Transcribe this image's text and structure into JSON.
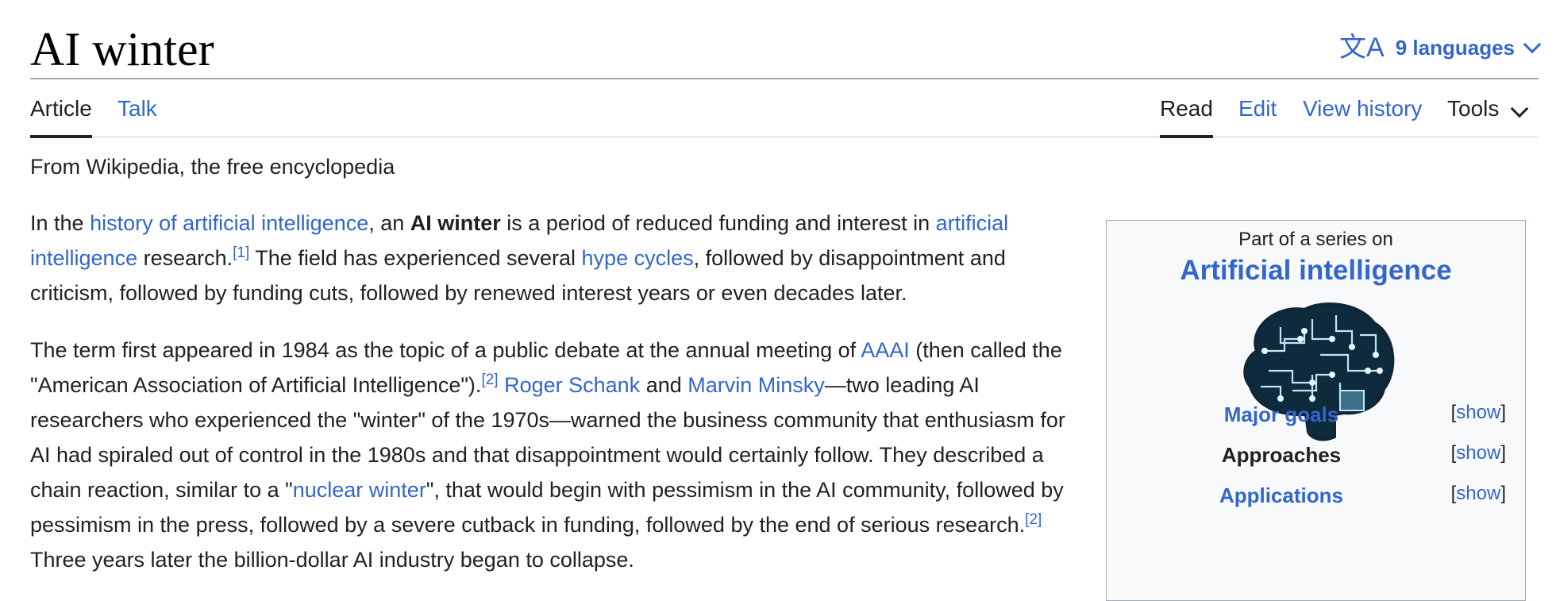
{
  "page": {
    "title": "AI winter",
    "languages_label": "9 languages",
    "tagline": "From Wikipedia, the free encyclopedia"
  },
  "tabs": {
    "left": [
      {
        "label": "Article",
        "active": true
      },
      {
        "label": "Talk",
        "active": false
      }
    ],
    "right": [
      {
        "label": "Read",
        "active": true
      },
      {
        "label": "Edit",
        "active": false
      },
      {
        "label": "View history",
        "active": false
      },
      {
        "label": "Tools",
        "active": false
      }
    ]
  },
  "para1": {
    "t1": "In the ",
    "link1": "history of artificial intelligence",
    "t2": ", an ",
    "bold": "AI winter",
    "t3": " is a period of reduced funding and interest in ",
    "link2": "artificial intelligence",
    "t4": " research.",
    "ref1": "[1]",
    "t5": " The field has experienced several ",
    "link3": "hype cycles",
    "t6": ", followed by disappointment and criticism, followed by funding cuts, followed by renewed interest years or even decades later."
  },
  "para2": {
    "t1": "The term first appeared in 1984 as the topic of a public debate at the annual meeting of ",
    "link1": "AAAI",
    "t2": " (then called the \"American Association of Artificial Intelligence\").",
    "ref1": "[2]",
    "t3": " ",
    "link2": "Roger Schank",
    "t4": " and ",
    "link3": "Marvin Minsky",
    "t5": "—two leading AI researchers who experienced the \"winter\" of the 1970s—warned the business community that enthusiasm for AI had spiraled out of control in the 1980s and that disappointment would certainly follow. They described a chain reaction, similar to a \"",
    "link4": "nuclear winter",
    "t6": "\", that would begin with pessimism in the AI community, followed by pessimism in the press, followed by a severe cutback in funding, followed by the end of serious research.",
    "ref2": "[2]",
    "t7": " Three years later the billion-dollar AI industry began to collapse."
  },
  "infobox": {
    "series_label": "Part of a series on",
    "series_title": "Artificial intelligence",
    "rows": [
      {
        "label": "Major goals",
        "is_link": true,
        "toggle": "show"
      },
      {
        "label": "Approaches",
        "is_link": false,
        "toggle": "show"
      },
      {
        "label": "Applications",
        "is_link": true,
        "toggle": "show"
      }
    ]
  },
  "colors": {
    "link": "#3366cc",
    "text": "#202122",
    "infobox_bg": "#f8f9fa",
    "border": "#a2a9b1"
  },
  "icons": [
    "translate-icon",
    "chevron-down-icon",
    "brain-circuit-image"
  ]
}
